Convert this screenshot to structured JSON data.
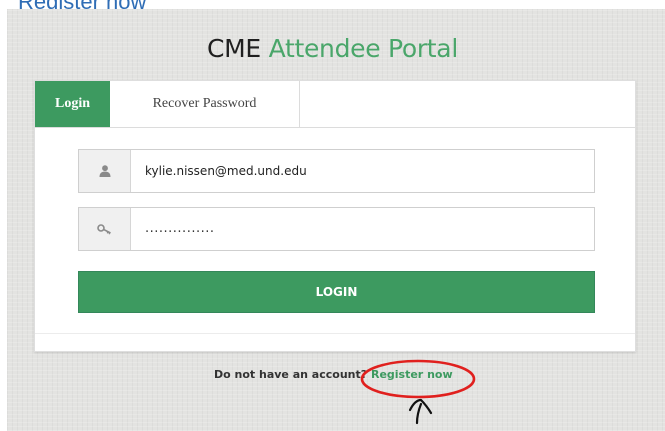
{
  "caption": {
    "text": "Register now"
  },
  "portal": {
    "title_part1": "CME",
    "title_part2": "Attendee Portal",
    "accent_color": "#3d9a60"
  },
  "tabs": [
    {
      "label": "Login",
      "active": true
    },
    {
      "label": "Recover Password",
      "active": false
    }
  ],
  "form": {
    "email": {
      "icon": "user-icon",
      "value": "kylie.nissen@med.und.edu"
    },
    "password": {
      "icon": "key-icon",
      "value": "...............",
      "masked": true
    },
    "login_button": "LOGIN"
  },
  "register": {
    "prompt": "Do not have an account?",
    "link": "Register now"
  },
  "annotations": {
    "highlight_color": "#e0201e",
    "shapes": [
      "ellipse-highlight-icon",
      "hand-drawn-arrow-icon"
    ]
  }
}
